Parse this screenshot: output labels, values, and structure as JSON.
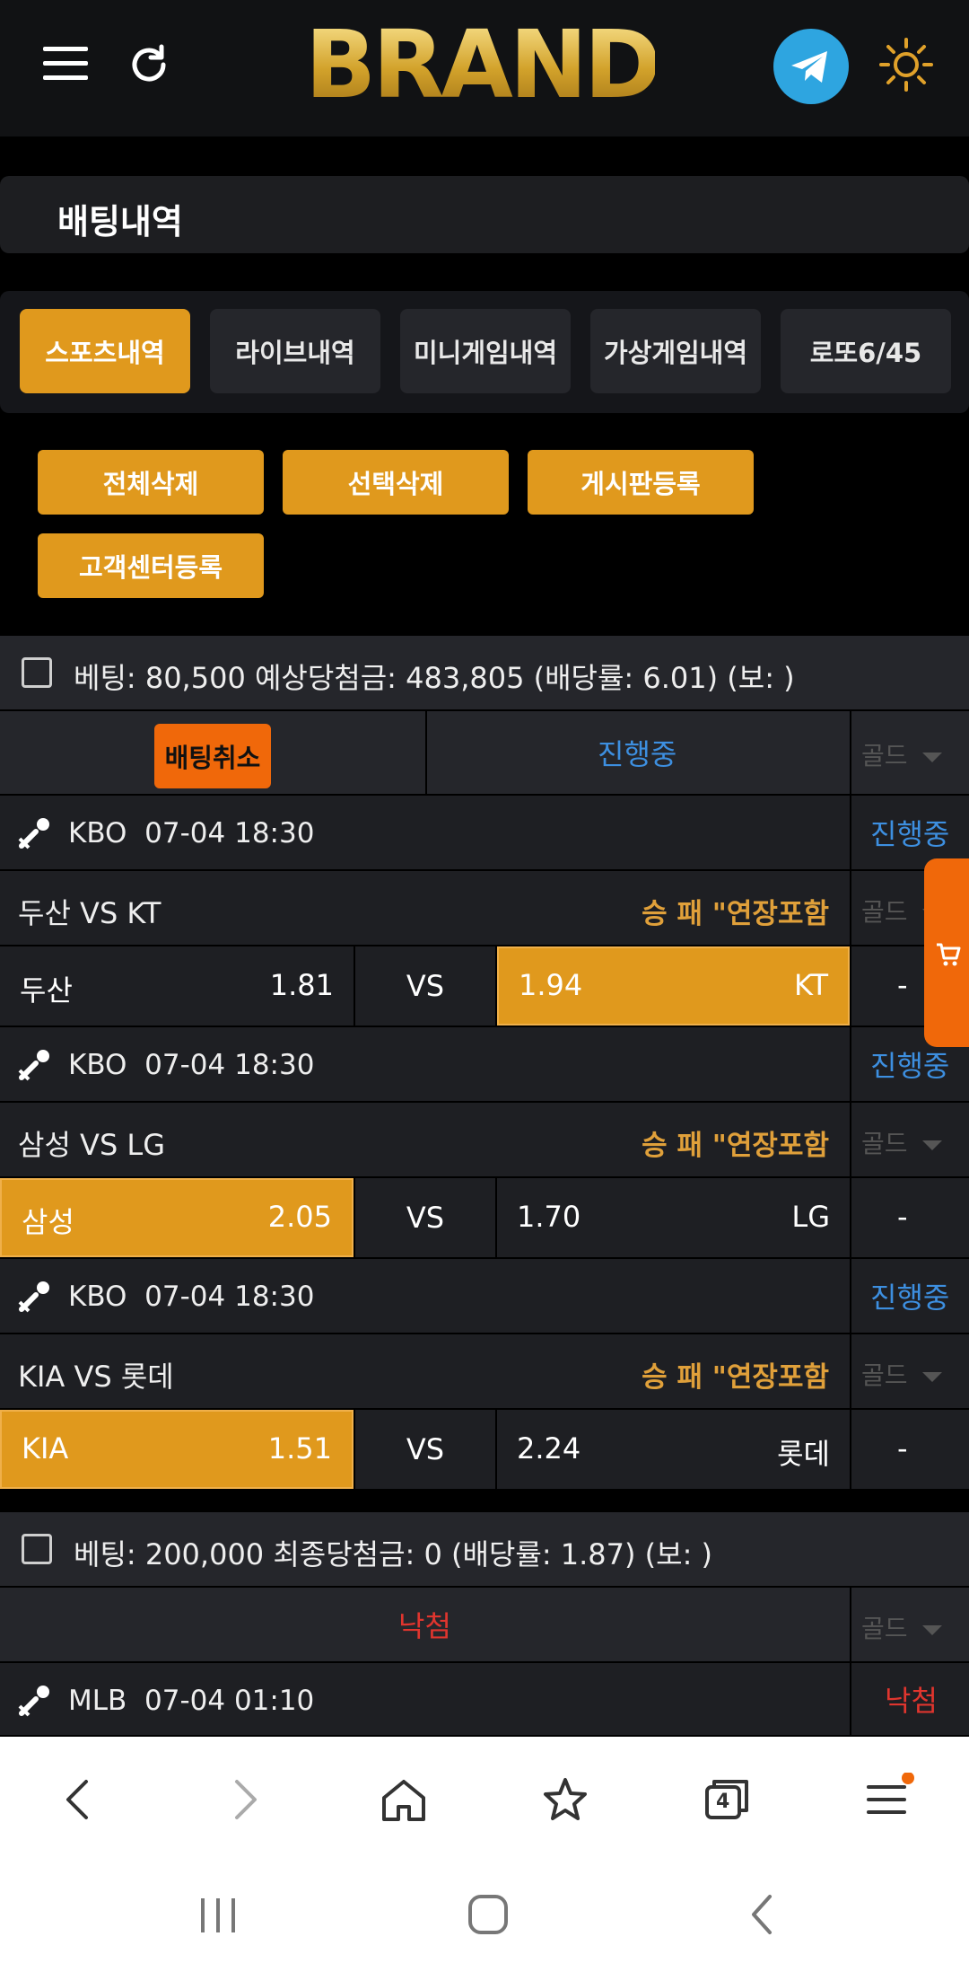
{
  "header": {
    "logo": "BRAND",
    "menu_icon": "hamburger-menu-icon",
    "refresh_icon": "refresh-icon",
    "telegram_icon": "telegram-icon",
    "theme_icon": "sun-icon",
    "accent": "#e0991d"
  },
  "page_title": "배팅내역",
  "tabs": [
    {
      "label": "스포츠내역",
      "active": true
    },
    {
      "label": "라이브내역",
      "active": false
    },
    {
      "label": "미니게임내역",
      "active": false
    },
    {
      "label": "가상게임내역",
      "active": false
    },
    {
      "label": "로또6/45",
      "active": false
    }
  ],
  "actions": {
    "delete_all": "전체삭제",
    "delete_selected": "선택삭제",
    "post_board": "게시판등록",
    "post_support": "고객센터등록"
  },
  "bet1": {
    "summary": "베팅: 80,500 예상당첨금: 483,805 (배당률: 6.01) (보: )",
    "cancel_label": "배팅취소",
    "status": "진행중",
    "gold": "골드",
    "games": [
      {
        "league": "KBO",
        "time": "07-04 18:30",
        "status": "진행중",
        "match": "두산 VS KT",
        "market": "승 패 \"연장포함",
        "gold": "골드",
        "home": "두산",
        "home_odds": "1.81",
        "vs": "VS",
        "away_odds": "1.94",
        "away": "KT",
        "selected": "away",
        "extra": "-"
      },
      {
        "league": "KBO",
        "time": "07-04 18:30",
        "status": "진행중",
        "match": "삼성 VS LG",
        "market": "승 패 \"연장포함",
        "gold": "골드",
        "home": "삼성",
        "home_odds": "2.05",
        "vs": "VS",
        "away_odds": "1.70",
        "away": "LG",
        "selected": "home",
        "extra": "-"
      },
      {
        "league": "KBO",
        "time": "07-04 18:30",
        "status": "진행중",
        "match": "KIA VS 롯데",
        "market": "승 패 \"연장포함",
        "gold": "골드",
        "home": "KIA",
        "home_odds": "1.51",
        "vs": "VS",
        "away_odds": "2.24",
        "away": "롯데",
        "selected": "home",
        "extra": "-"
      }
    ]
  },
  "bet2": {
    "summary": "베팅: 200,000 최종당첨금: 0 (배당률: 1.87) (보: )",
    "status": "낙첨",
    "gold": "골드",
    "game": {
      "league": "MLB",
      "time": "07-04 01:10",
      "status": "낙첨"
    }
  },
  "cart_icon": "cart-icon",
  "browser": {
    "tab_count": "4",
    "icons": [
      "back-icon",
      "forward-icon",
      "home-icon",
      "bookmark-star-icon",
      "tabs-icon",
      "browser-menu-icon"
    ]
  },
  "system_nav": [
    "recents-icon",
    "home-button-icon",
    "system-back-icon"
  ]
}
